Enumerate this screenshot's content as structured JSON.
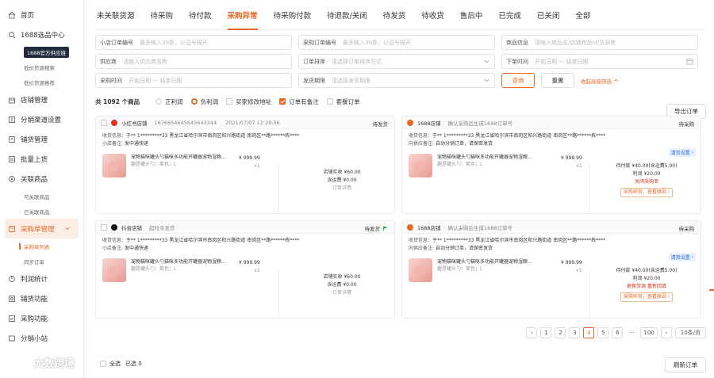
{
  "sidebar": {
    "items": [
      {
        "label": "首页",
        "icon": "home-icon"
      },
      {
        "label": "1688选品中心",
        "icon": "search-icon",
        "expanded": true
      },
      {
        "label": "1688官方供应链",
        "sub": true,
        "badge": true
      },
      {
        "label": "低价货源搜索",
        "sub": true
      },
      {
        "label": "低价货源推荐",
        "sub": true
      },
      {
        "label": "店铺管理",
        "icon": "store-icon"
      },
      {
        "label": "分销渠道设置",
        "icon": "channel-icon"
      },
      {
        "label": "铺货管理",
        "icon": "upload-icon"
      },
      {
        "label": "批量上货",
        "icon": "batch-icon"
      },
      {
        "label": "关联商品",
        "icon": "link-icon",
        "expanded": true
      },
      {
        "label": "可关联商品",
        "sub": true
      },
      {
        "label": "已关联商品",
        "sub": true
      },
      {
        "label": "采购单管理",
        "icon": "cart-icon",
        "active": true
      },
      {
        "label": "采购单列表",
        "sub": true,
        "active": true
      },
      {
        "label": "同步订单",
        "sub": true
      },
      {
        "label": "利润统计",
        "icon": "chart-icon"
      },
      {
        "label": "铺货功能",
        "icon": "tool-icon"
      },
      {
        "label": "采购功能",
        "icon": "purchase-icon"
      },
      {
        "label": "分销小站",
        "icon": "site-icon"
      }
    ]
  },
  "tabs": [
    "未关联货源",
    "待采购",
    "待付款",
    "采购异常",
    "待采购付款",
    "待退款/关闭",
    "待发货",
    "待收货",
    "售后中",
    "已完成",
    "已关闭",
    "全部"
  ],
  "active_tab": 3,
  "filters": {
    "row1": [
      {
        "label": "小店订单编号",
        "placeholder": "最多输入30条，以逗号隔开"
      },
      {
        "label": "采购订单编号",
        "placeholder": "最多输入30条，以逗号隔开"
      },
      {
        "label": "商品信息",
        "placeholder": "请输入商品名/店铺商品id/货源商"
      }
    ],
    "row2": [
      {
        "label": "供应商",
        "placeholder": "请输入供应商名称"
      },
      {
        "label": "订单排序",
        "placeholder": "请选择订单排序方式"
      },
      {
        "label": "下单时间",
        "placeholder": "开始日期 ～ 结束日期"
      }
    ],
    "row3": [
      {
        "label": "采购时间",
        "placeholder": "开始日期 ～ 结束日期"
      },
      {
        "label": "发货期限",
        "placeholder": "请选择发货期限"
      }
    ],
    "query_label": "查询",
    "reset_label": "重置",
    "collapse_label": "收起高级筛选"
  },
  "toolbar": {
    "count": "共 1092 个商品",
    "options": [
      {
        "label": "正利润",
        "type": "radio",
        "on": false
      },
      {
        "label": "负利润",
        "type": "radio",
        "on": true
      },
      {
        "label": "买家修改地址",
        "type": "check",
        "on": false
      },
      {
        "label": "订单有备注",
        "type": "check",
        "on": true
      },
      {
        "label": "套餐订单",
        "type": "check",
        "on": false
      }
    ],
    "export_label": "导出订单"
  },
  "cards": [
    {
      "shop": "小红书店铺",
      "shop_color": "#e0301e",
      "order_id": "1676654645645643344",
      "time": "2021/07/07 12:29:56",
      "status": "待发货",
      "receiver": "于** 1*********33 黑龙江省哈尔滨市南岗区和兴路街道 南岗区**路******栋****",
      "remark_label": "小店备注:",
      "remark": "发中通快递",
      "product": "宠物猫咪罐头勺猫咪多功能开罐器宠物湿粮...",
      "sku": "趣是罐头勺：紫色；L",
      "price": "¥ 999.99",
      "qty": "x1",
      "pay": [
        "店铺实收 ¥60.00",
        "含运费 ¥0.00",
        "订单详情"
      ]
    },
    {
      "shop": "1688店铺",
      "shop_color": "#e96826",
      "order_id": "确认采购后生成1688订单号",
      "time": "",
      "status": "待采购",
      "receiver": "于** 1*********33 黑龙江省哈尔滨市南岗区和兴路街道 南岗区**路******栋****",
      "remark_label": "向供应备注:",
      "remark": "自动分销订单，请保密发货",
      "notice": "请货设置",
      "product": "宠物猫咪罐头勺猫咪多功能开罐器宠物湿粮...",
      "sku": "趣是罐头勺：紫色；L",
      "price": "¥ 999.99",
      "qty": "x1",
      "pay": [
        "待付款 ¥40.00(含运费5.00)",
        "利润 ¥20.00",
        "关闭采购单"
      ],
      "tag": "采购异常，查看原因"
    },
    {
      "shop": "抖音店铺",
      "shop_color": "#111111",
      "order_id": "超时未发货",
      "time": "",
      "status": "待发货",
      "receiver": "于** 1*********33 黑龙江省哈尔滨市南岗区和兴路街道 南岗区**路******栋****",
      "remark_label": "小店备注:",
      "remark": "发中通快递",
      "product": "宠物猫咪罐头勺猫咪多功能开罐器宠物湿粮...",
      "sku": "趣是罐头勺：紫色；L",
      "price": "¥ 999.99",
      "qty": "x1",
      "pay": [
        "店铺实收 ¥60.00",
        "含运费 ¥0.00",
        "订单详情"
      ]
    },
    {
      "shop": "1688店铺",
      "shop_color": "#e96826",
      "order_id": "确认采购后生成1688订单号",
      "time": "",
      "status": "待采购",
      "receiver": "于** 1*********33 黑龙江省哈尔滨市南岗区和兴路街道 南岗区**路******栋****",
      "remark_label": "向供应备注:",
      "remark": "自动分销订单，请保密发货",
      "notice": "请货设置",
      "product": "宠物猫咪罐头勺猫咪多功能开罐器宠物湿粮...",
      "sku": "趣是罐头勺：紫色；L",
      "price": "¥ 999.99",
      "qty": "x1",
      "pay": [
        "待付款 ¥40.00(含运费5.00)",
        "利润 ¥20.00",
        "更换货源  重新回填"
      ],
      "tag": "采购异常，查看原因"
    }
  ],
  "pager": {
    "pages": [
      "1",
      "2",
      "3",
      "4",
      "5",
      "6",
      "···",
      "100"
    ],
    "current": "4",
    "size": "10条/页"
  },
  "bottom": {
    "select_all": "全选",
    "selected": "已选 0",
    "refresh": "刷新订单"
  },
  "watermark": "大数跨境",
  "colors": {
    "accent": "#e96826",
    "danger": "#e0301e",
    "info": "#1c63d6"
  }
}
